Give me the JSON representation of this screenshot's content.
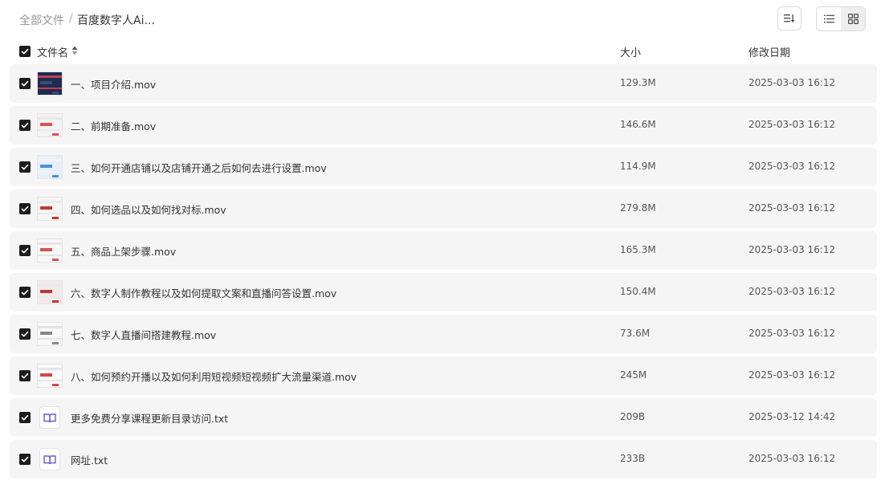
{
  "breadcrumb": {
    "root": "全部文件",
    "separator": "/",
    "current": "百度数字人Ai..."
  },
  "columns": {
    "name": "文件名",
    "size": "大小",
    "date": "修改日期"
  },
  "files": [
    {
      "name": "一、项目介绍.mov",
      "size": "129.3M",
      "date": "2025-03-03 16:12",
      "icon": "video-thumbnail-icon"
    },
    {
      "name": "二、前期准备.mov",
      "size": "146.6M",
      "date": "2025-03-03 16:12",
      "icon": "video-thumbnail-icon"
    },
    {
      "name": "三、如何开通店铺以及店铺开通之后如何去进行设置.mov",
      "size": "114.9M",
      "date": "2025-03-03 16:12",
      "icon": "video-thumbnail-icon"
    },
    {
      "name": "四、如何选品以及如何找对标.mov",
      "size": "279.8M",
      "date": "2025-03-03 16:12",
      "icon": "video-thumbnail-icon"
    },
    {
      "name": "五、商品上架步骤.mov",
      "size": "165.3M",
      "date": "2025-03-03 16:12",
      "icon": "video-thumbnail-icon"
    },
    {
      "name": "六、数字人制作教程以及如何提取文案和直播问答设置.mov",
      "size": "150.4M",
      "date": "2025-03-03 16:12",
      "icon": "video-thumbnail-icon"
    },
    {
      "name": "七、数字人直播间搭建教程.mov",
      "size": "73.6M",
      "date": "2025-03-03 16:12",
      "icon": "video-thumbnail-icon"
    },
    {
      "name": "八、如何预约开播以及如何利用短视频短视频扩大流量渠道.mov",
      "size": "245M",
      "date": "2025-03-03 16:12",
      "icon": "video-thumbnail-icon"
    },
    {
      "name": "更多免费分享课程更新目录访问.txt",
      "size": "209B",
      "date": "2025-03-12 14:42",
      "icon": "text-file-icon"
    },
    {
      "name": "网址.txt",
      "size": "233B",
      "date": "2025-03-03 16:12",
      "icon": "text-file-icon"
    }
  ],
  "colors": {
    "row_bg": "#f5f5f6",
    "checkbox": "#1c1c1c",
    "txt_icon": "#6b5bd6"
  }
}
